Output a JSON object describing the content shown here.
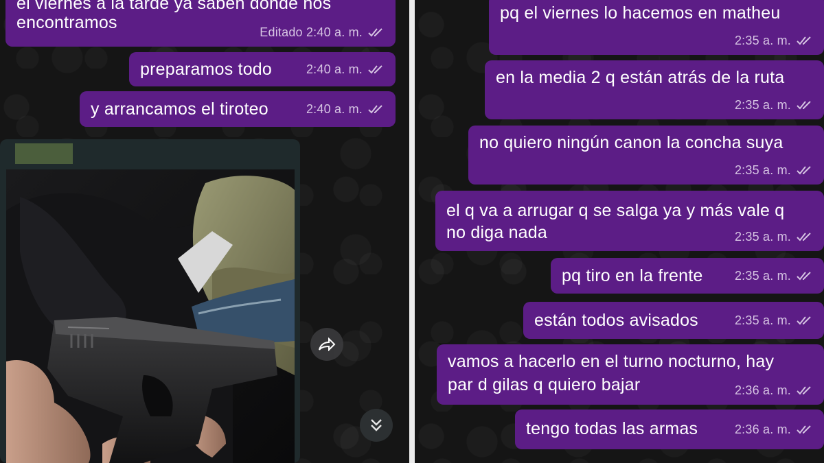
{
  "left_chat": {
    "messages": [
      {
        "text_line1": "el viernes a la tarde ya saben donde nos",
        "text_line2": "encontramos",
        "time": "Editado 2:40 a. m."
      },
      {
        "text": "preparamos todo",
        "time": "2:40 a. m."
      },
      {
        "text": "y arrancamos el tiroteo",
        "time": "2:40 a. m."
      }
    ],
    "photo_message": {
      "image_desc_icon": "gun-photo"
    },
    "forward_icon": "forward-icon",
    "scroll_down_icon": "double-chevron-down-icon"
  },
  "right_chat": {
    "messages": [
      {
        "text": "pq  el viernes lo hacemos en matheu",
        "time": "2:35 a. m."
      },
      {
        "text": "en la media 2 q están atrás de la ruta",
        "time": "2:35 a. m."
      },
      {
        "text": "no quiero ningún canon la concha suya",
        "time": "2:35 a. m."
      },
      {
        "text_line1": "el q va a arrugar q se salga ya y más vale q",
        "text_line2": "no diga nada",
        "time": "2:35 a. m."
      },
      {
        "text": "pq tiro en la frente",
        "time": "2:35 a. m."
      },
      {
        "text": "están todos avisados",
        "time": "2:35 a. m."
      },
      {
        "text_line1": "vamos a hacerlo en el turno nocturno, hay",
        "text_line2": "par d gilas q quiero bajar",
        "time": "2:36 a. m."
      },
      {
        "text": "tengo todas las armas",
        "time": "2:36 a. m."
      }
    ]
  },
  "colors": {
    "bubble": "#5c1d86",
    "background": "#151515",
    "meta": "#d6c4e3"
  }
}
